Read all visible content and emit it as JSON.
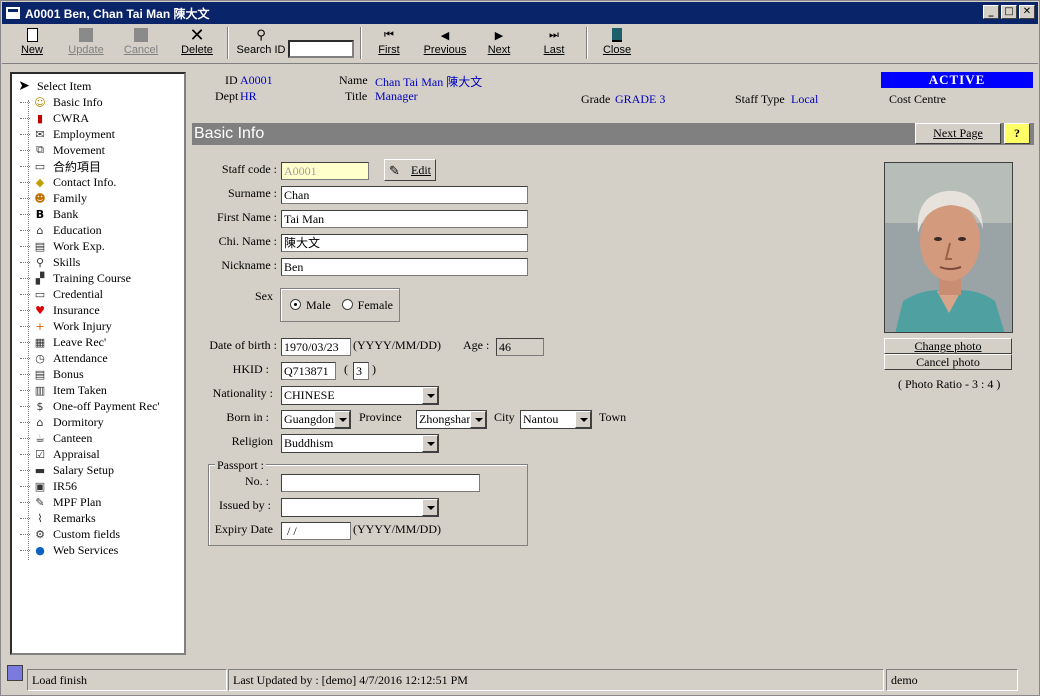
{
  "window": {
    "title": "A0001 Ben, Chan Tai Man 陳大文"
  },
  "toolbar": {
    "new": "New",
    "update": "Update",
    "cancel": "Cancel",
    "delete": "Delete",
    "search_label": "Search ID",
    "search_value": "",
    "first": "First",
    "previous": "Previous",
    "next": "Next",
    "last": "Last",
    "close": "Close"
  },
  "tree": {
    "root": "Select Item",
    "items": [
      {
        "label": "Basic Info",
        "icon": "person-icon"
      },
      {
        "label": "CWRA",
        "icon": "book-icon"
      },
      {
        "label": "Employment",
        "icon": "mail-icon"
      },
      {
        "label": "Movement",
        "icon": "tree-icon"
      },
      {
        "label": "合約項目",
        "icon": "folder-icon"
      },
      {
        "label": "Contact Info.",
        "icon": "contact-icon"
      },
      {
        "label": "Family",
        "icon": "family-icon"
      },
      {
        "label": "Bank",
        "icon": "bank-icon"
      },
      {
        "label": "Education",
        "icon": "education-icon"
      },
      {
        "label": "Work Exp.",
        "icon": "document-icon"
      },
      {
        "label": "Skills",
        "icon": "wrench-icon"
      },
      {
        "label": "Training Course",
        "icon": "training-icon"
      },
      {
        "label": "Credential",
        "icon": "credential-icon"
      },
      {
        "label": "Insurance",
        "icon": "heart-icon"
      },
      {
        "label": "Work Injury",
        "icon": "injury-icon"
      },
      {
        "label": "Leave Rec'",
        "icon": "calendar-icon"
      },
      {
        "label": "Attendance",
        "icon": "clock-icon"
      },
      {
        "label": "Bonus",
        "icon": "bonus-icon"
      },
      {
        "label": "Item Taken",
        "icon": "item-icon"
      },
      {
        "label": "One-off Payment Rec'",
        "icon": "dollar-icon"
      },
      {
        "label": "Dormitory",
        "icon": "house-icon"
      },
      {
        "label": "Canteen",
        "icon": "canteen-icon"
      },
      {
        "label": "Appraisal",
        "icon": "check-icon"
      },
      {
        "label": "Salary Setup",
        "icon": "salary-icon"
      },
      {
        "label": "IR56",
        "icon": "disk-icon"
      },
      {
        "label": "MPF Plan",
        "icon": "mpf-icon"
      },
      {
        "label": "Remarks",
        "icon": "paperclip-icon"
      },
      {
        "label": "Custom fields",
        "icon": "custom-icon"
      },
      {
        "label": "Web Services",
        "icon": "globe-icon"
      }
    ]
  },
  "header": {
    "id_label": "ID",
    "id_value": "A0001",
    "dept_label": "Dept",
    "dept_value": "HR",
    "name_label": "Name",
    "name_value": "Chan Tai Man 陳大文",
    "title_label": "Title",
    "title_value": "Manager",
    "grade_label": "Grade",
    "grade_value": "GRADE 3",
    "staff_type_label": "Staff Type",
    "staff_type_value": "Local",
    "cost_centre_label": "Cost Centre",
    "status": "ACTIVE"
  },
  "section": {
    "title": "Basic Info",
    "next_page": "Next Page",
    "help": "?"
  },
  "form": {
    "staff_code_label": "Staff code :",
    "staff_code": "A0001",
    "edit": "Edit",
    "surname_label": "Surname :",
    "surname": "Chan",
    "first_name_label": "First Name :",
    "first_name": "Tai Man",
    "chi_name_label": "Chi. Name :",
    "chi_name": "陳大文",
    "nickname_label": "Nickname :",
    "nickname": "Ben",
    "sex_label": "Sex",
    "sex_male": "Male",
    "sex_female": "Female",
    "dob_label": "Date of birth :",
    "dob": "1970/03/23",
    "dob_format": "(YYYY/MM/DD)",
    "age_label": "Age :",
    "age": "46",
    "hkid_label": "HKID :",
    "hkid": "Q713871",
    "hkid_open": "(",
    "hkid_check": "3",
    "hkid_close": ")",
    "nationality_label": "Nationality :",
    "nationality": "CHINESE",
    "born_in_label": "Born in :",
    "born_in": "Guangdong",
    "province_label": "Province",
    "province": "Zhongshan",
    "city_label": "City",
    "city": "Nantou",
    "town_label": "Town",
    "religion_label": "Religion",
    "religion": "Buddhism",
    "passport_group": "Passport :",
    "passport_no_label": "No. :",
    "passport_no": "",
    "issued_by_label": "Issued by :",
    "issued_by": "",
    "expiry_label": "Expiry Date",
    "expiry": " / /",
    "expiry_format": "(YYYY/MM/DD)"
  },
  "photo": {
    "change": "Change photo",
    "cancel": "Cancel photo",
    "ratio": "( Photo Ratio - 3 : 4 )"
  },
  "status": {
    "message": "Load finish",
    "updated": "Last Updated by : [demo]  4/7/2016 12:12:51 PM",
    "user": "demo"
  }
}
